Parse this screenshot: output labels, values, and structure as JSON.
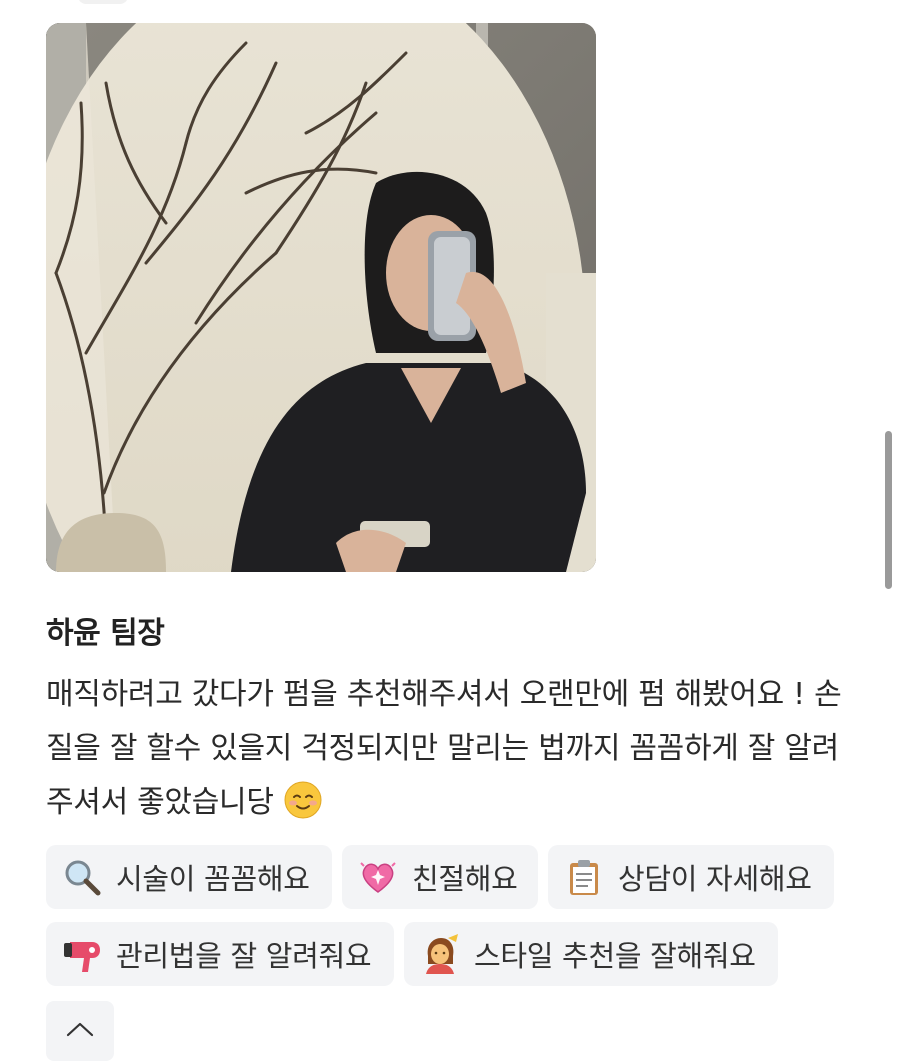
{
  "review": {
    "designer_name": "하윤 팀장",
    "text": "매직하려고 갔다가 펌을 추천해주셔서 오랜만에 펌 해봤어요 ! 손질을 잘 할수 있을지 걱정되지만 말리는 법까지 꼼꼼하게 잘 알려주셔서 좋았습니당",
    "text_emoji": "smiling-face-icon",
    "photo_name": "review-photo"
  },
  "tags": [
    {
      "label": "시술이 꼼꼼해요",
      "icon": "magnifying-glass-icon"
    },
    {
      "label": "친절해요",
      "icon": "sparkling-heart-icon"
    },
    {
      "label": "상담이 자세해요",
      "icon": "clipboard-icon"
    },
    {
      "label": "관리법을 잘 알려줘요",
      "icon": "hair-dryer-icon"
    },
    {
      "label": "스타일 추천을 잘해줘요",
      "icon": "haircut-person-icon"
    }
  ],
  "collapse": {
    "icon": "chevron-up-icon"
  }
}
